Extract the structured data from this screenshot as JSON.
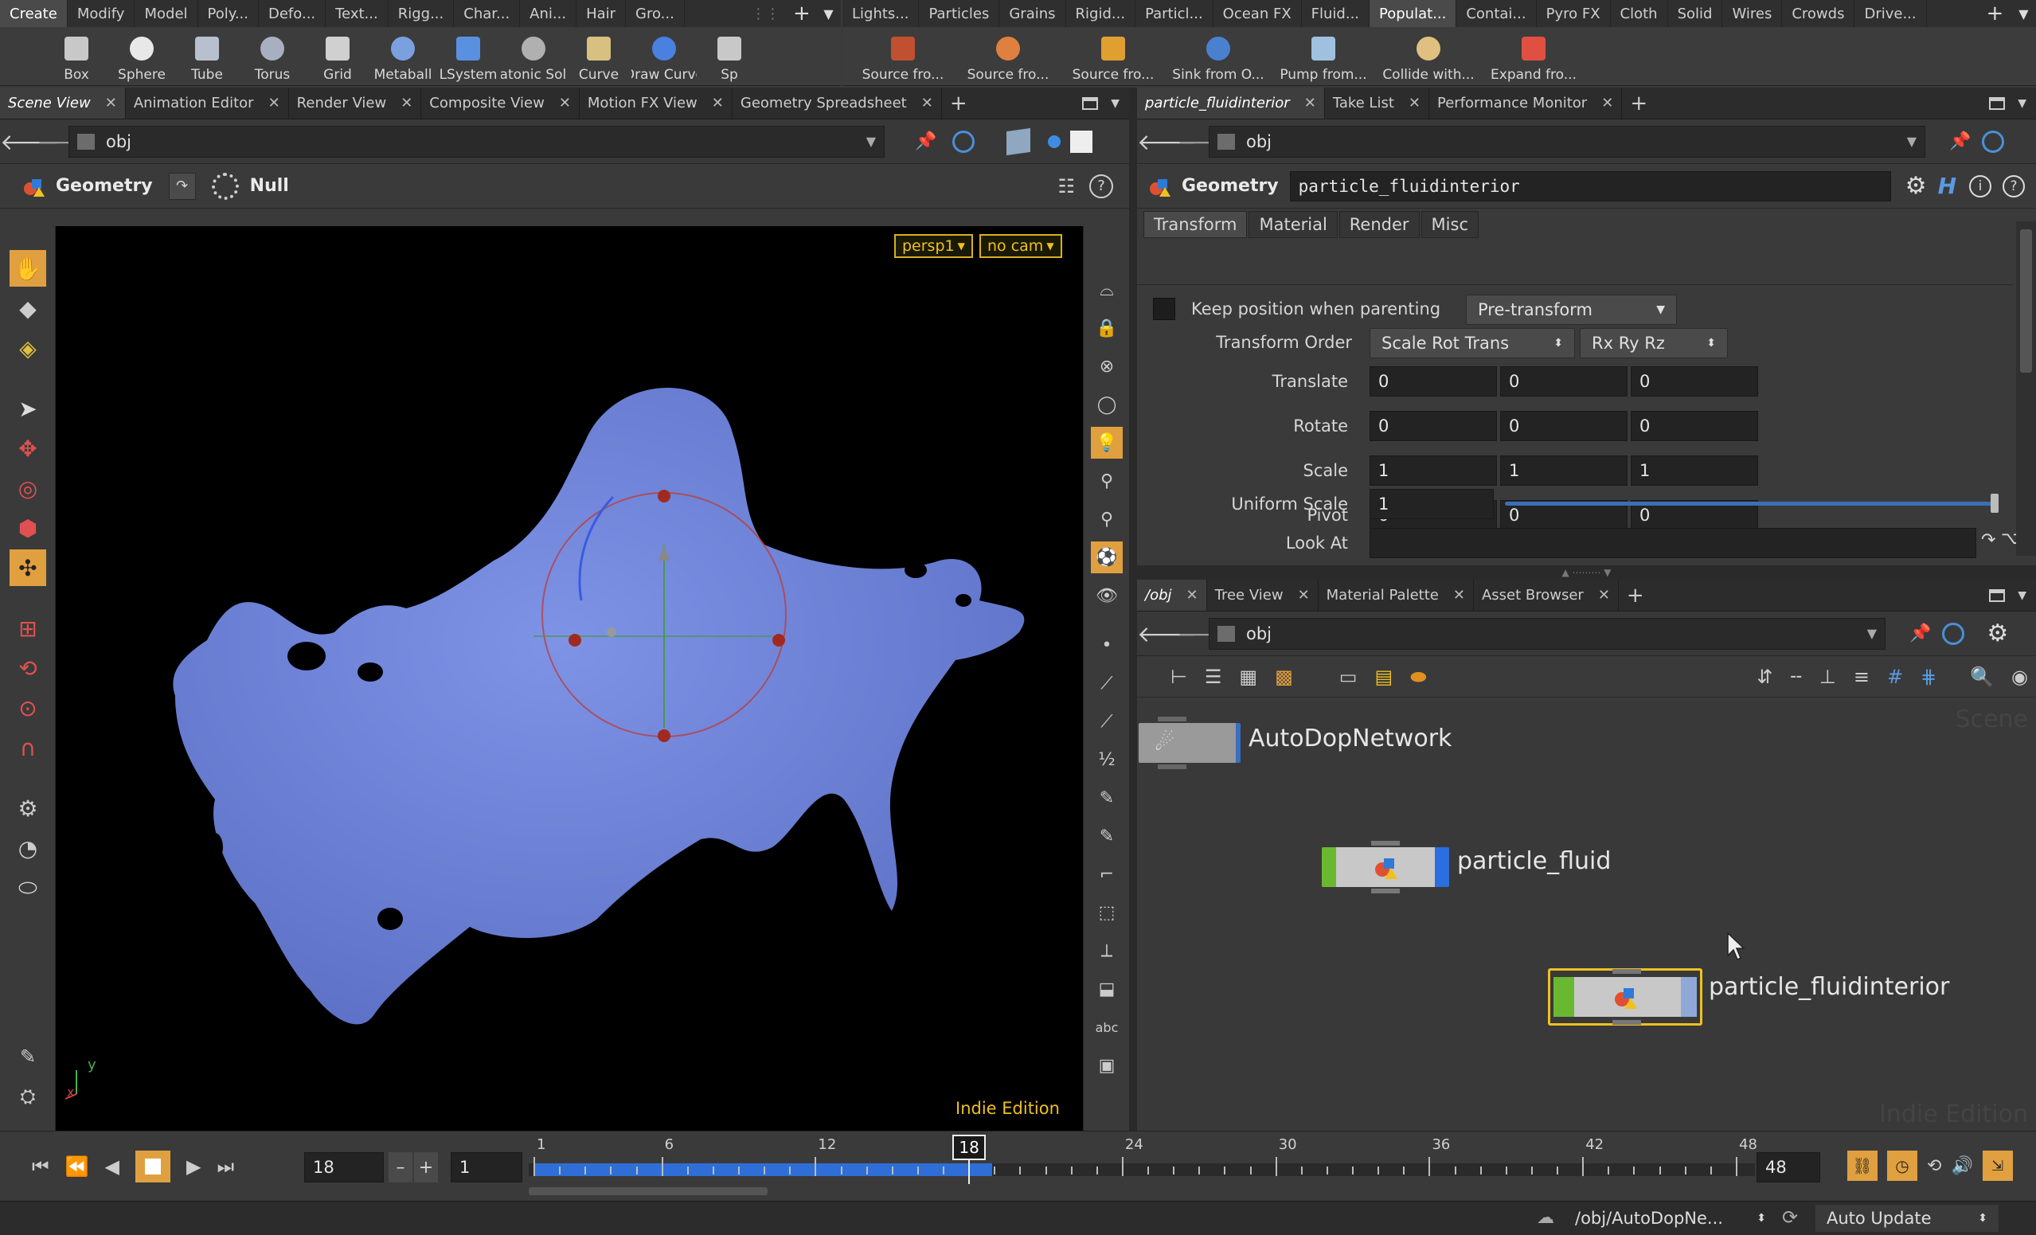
{
  "shelf_left": {
    "tabs": [
      "Create",
      "Modify",
      "Model",
      "Poly...",
      "Defo...",
      "Text...",
      "Rigg...",
      "Char...",
      "Ani...",
      "Hair",
      "Gro..."
    ],
    "active": 0,
    "tools": [
      "Box",
      "Sphere",
      "Tube",
      "Torus",
      "Grid",
      "Metaball",
      "LSystem",
      "Platonic Sol...",
      "Curve",
      "Draw Curve",
      "Sp"
    ]
  },
  "shelf_right": {
    "tabs": [
      "Lights...",
      "Particles",
      "Grains",
      "Rigid...",
      "Particl...",
      "Ocean FX",
      "Fluid...",
      "Populat...",
      "Contai...",
      "Pyro FX",
      "Cloth",
      "Solid",
      "Wires",
      "Crowds",
      "Drive..."
    ],
    "active": 7,
    "tools": [
      "Source fro...",
      "Source fro...",
      "Source fro...",
      "Sink from O...",
      "Pump from...",
      "Collide with...",
      "Expand fro..."
    ]
  },
  "left_pane": {
    "tabs": [
      "Scene View",
      "Animation Editor",
      "Render View",
      "Composite View",
      "Motion FX View",
      "Geometry Spreadsheet"
    ],
    "path": "obj",
    "context": "Geometry",
    "op": "Null",
    "camera": "persp1",
    "nocam": "no cam",
    "edition": "Indie Edition",
    "axis_y": "y",
    "axis_x": "x"
  },
  "params": {
    "tabs": [
      "particle_fluidinterior",
      "Take List",
      "Performance Monitor"
    ],
    "path": "obj",
    "type": "Geometry",
    "name": "particle_fluidinterior",
    "subtabs": [
      "Transform",
      "Material",
      "Render",
      "Misc"
    ],
    "keep_position_label": "Keep position when parenting",
    "keep_position_mode": "Pre-transform",
    "transform_order_label": "Transform Order",
    "transform_order": "Scale Rot Trans",
    "rot_order": "Rx Ry Rz",
    "translate_label": "Translate",
    "translate": [
      "0",
      "0",
      "0"
    ],
    "rotate_label": "Rotate",
    "rotate": [
      "0",
      "0",
      "0"
    ],
    "scale_label": "Scale",
    "scale": [
      "1",
      "1",
      "1"
    ],
    "pivot_label": "Pivot",
    "pivot": [
      "0",
      "0",
      "0"
    ],
    "uniform_scale_label": "Uniform Scale",
    "uniform_scale": "1",
    "uniform_scale_level": 1.0,
    "look_at_label": "Look At",
    "look_at": ""
  },
  "network": {
    "tabs": [
      "/obj",
      "Tree View",
      "Material Palette",
      "Asset Browser"
    ],
    "path": "obj",
    "watermark_top": "Scene",
    "watermark_bottom": "Indie Edition",
    "nodes": [
      "AutoDopNetwork",
      "particle_fluid",
      "particle_fluidinterior"
    ]
  },
  "timeline": {
    "current_frame": "18",
    "step": "1",
    "start": 1,
    "end": 48,
    "end_label": "48",
    "ticks": [
      "1",
      "6",
      "12",
      "18",
      "24",
      "30",
      "36",
      "42",
      "48"
    ]
  },
  "status": {
    "path": "/obj/AutoDopNe...",
    "update_mode": "Auto Update"
  },
  "colors": {
    "fluid": "#6f84d8",
    "selected": "#f0c020",
    "timeline_blue": "#2f6ed6"
  }
}
